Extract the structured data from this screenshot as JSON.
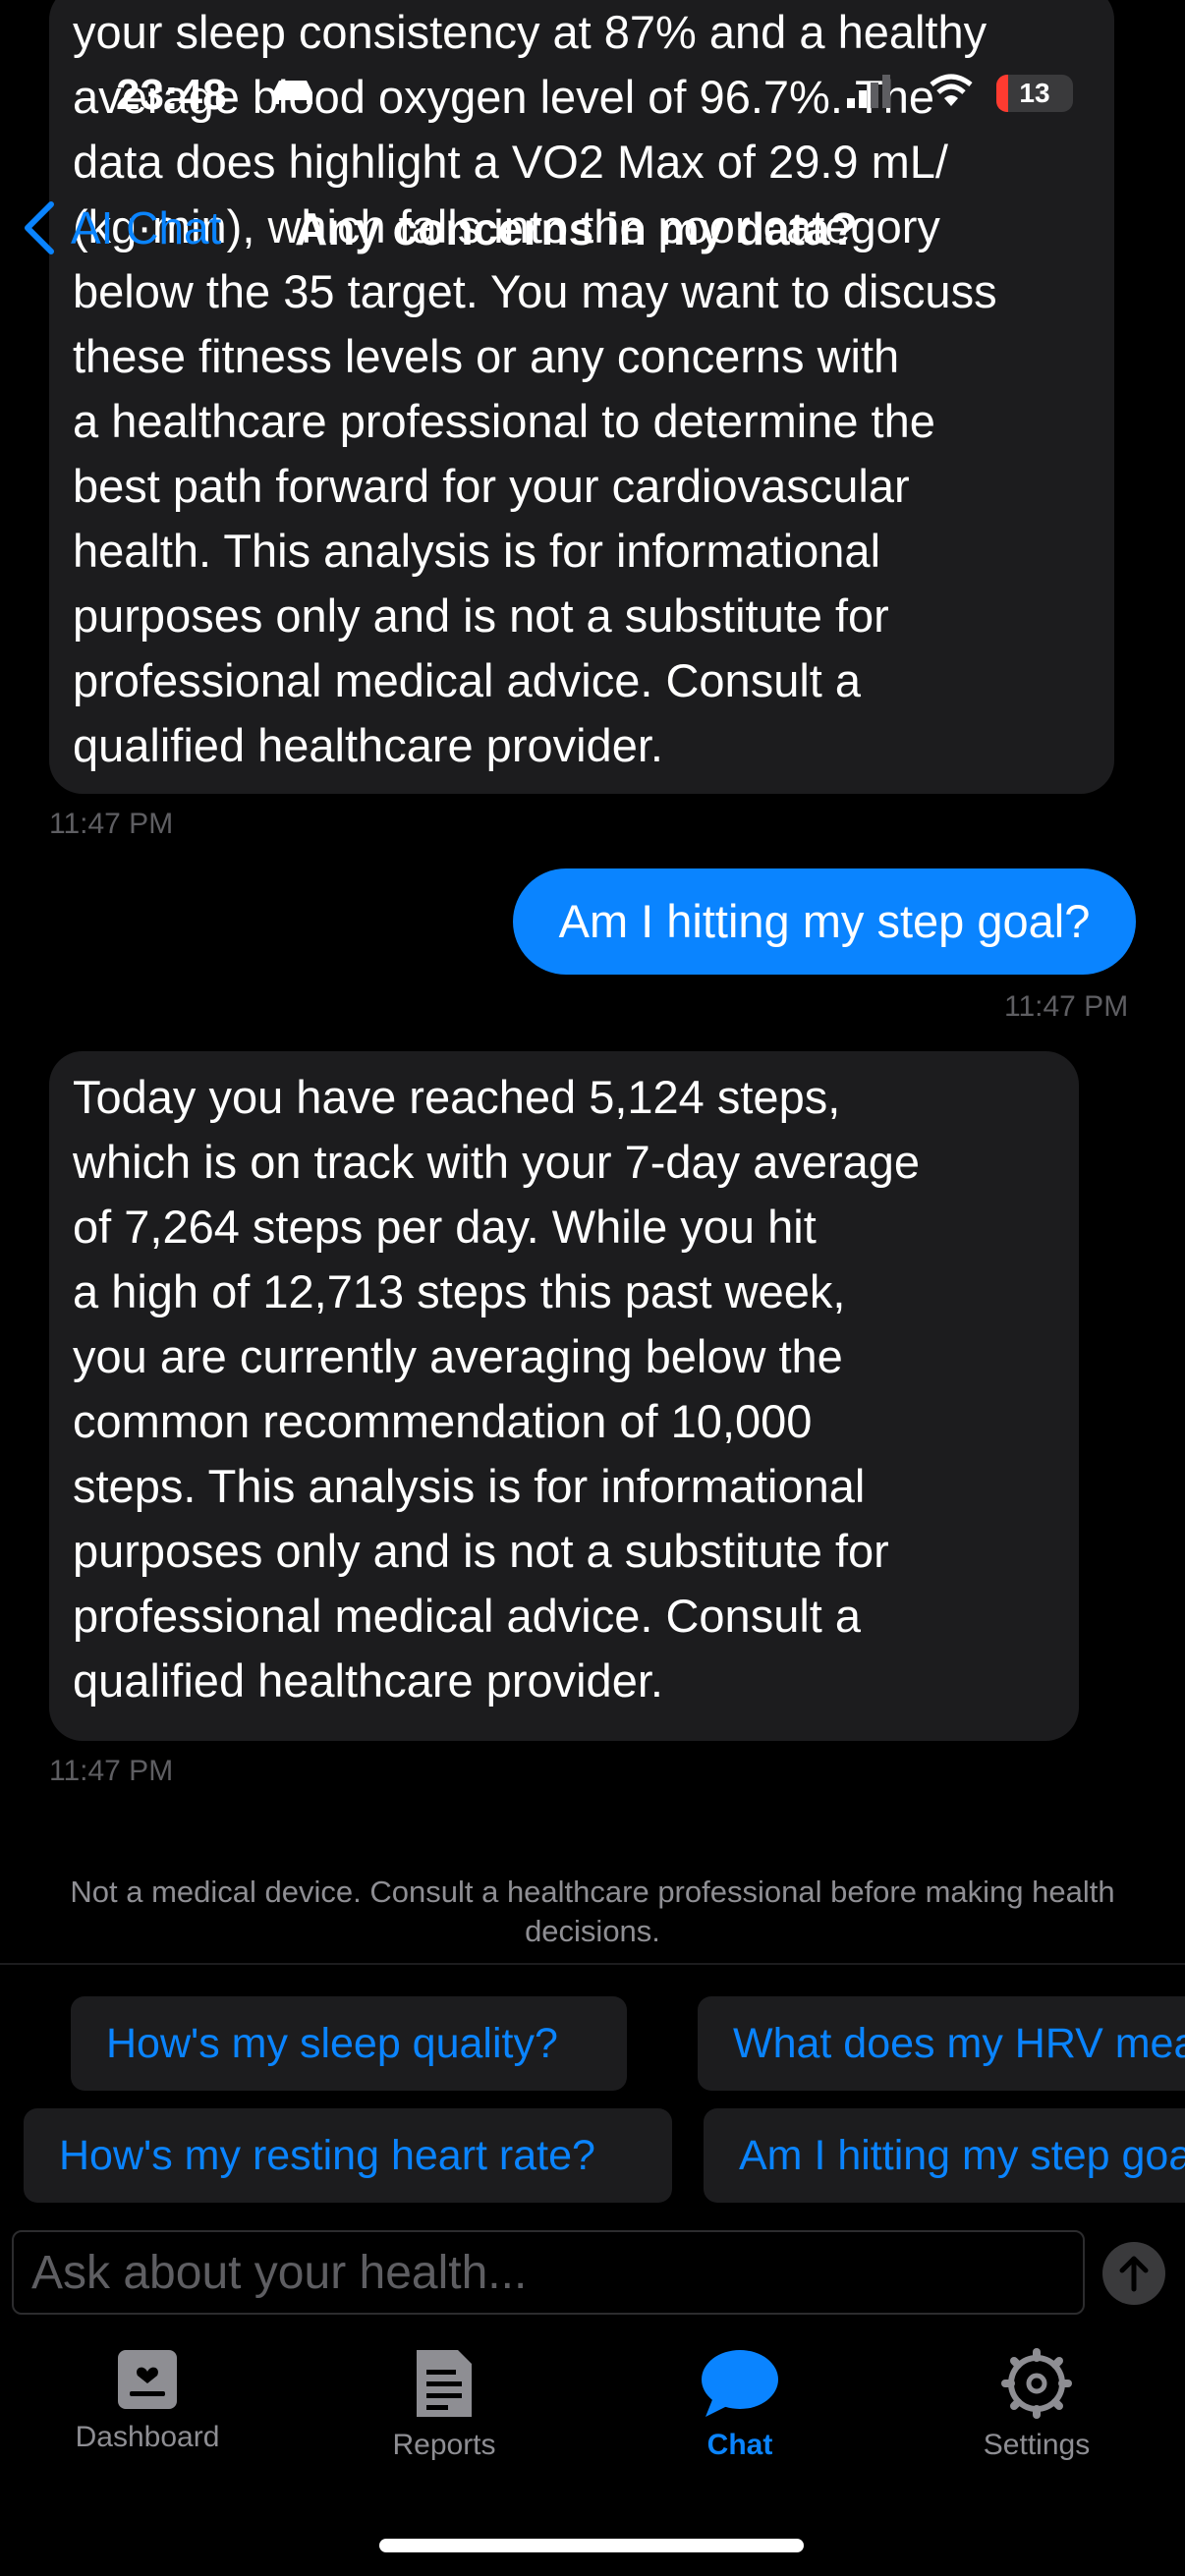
{
  "status_bar": {
    "time": "23:48",
    "battery_level": "13"
  },
  "nav": {
    "back_label": "AI Chat",
    "title": "Any concerns in my data?"
  },
  "messages": [
    {
      "role": "assistant",
      "lines": [
        "your sleep consistency at 87% and a healthy",
        "average blood oxygen level of 96.7%. The",
        "data does highlight a VO2 Max of 29.9 mL/",
        "(kg·min), which falls into the poor category",
        "below the 35 target. You may want to discuss",
        "these fitness levels or any concerns with",
        "a healthcare professional to determine the",
        "best path forward for your cardiovascular",
        "health. This analysis is for informational",
        "purposes only and is not a substitute for",
        "professional medical advice. Consult a",
        "qualified healthcare provider."
      ],
      "time": "11:47 PM"
    },
    {
      "role": "user",
      "text": "Am I hitting my step goal?",
      "time": "11:47 PM"
    },
    {
      "role": "assistant",
      "lines": [
        "Today you have reached 5,124 steps,",
        "which is on track with your 7-day average",
        "of 7,264 steps per day. While you hit",
        "a high of 12,713 steps this past week,",
        "you are currently averaging below the",
        "common recommendation of 10,000",
        "steps. This analysis is for informational",
        "purposes only and is not a substitute for",
        "professional medical advice. Consult a",
        "qualified healthcare provider."
      ],
      "time": "11:47 PM"
    }
  ],
  "disclaimer": "Not a medical device. Consult a healthcare professional before making health decisions.",
  "suggestions": {
    "row1": [
      "How's my sleep quality?",
      "What does my HRV mean?"
    ],
    "row2": [
      "How's my resting heart rate?",
      "Am I hitting my step goal?"
    ]
  },
  "input": {
    "placeholder": "Ask about your health..."
  },
  "tabs": [
    {
      "label": "Dashboard",
      "icon": "dashboard-icon"
    },
    {
      "label": "Reports",
      "icon": "reports-icon"
    },
    {
      "label": "Chat",
      "icon": "chat-icon",
      "active": true
    },
    {
      "label": "Settings",
      "icon": "settings-icon"
    }
  ],
  "colors": {
    "accent": "#0a84ff",
    "bubble": "#1c1c1e",
    "background": "#000000"
  }
}
